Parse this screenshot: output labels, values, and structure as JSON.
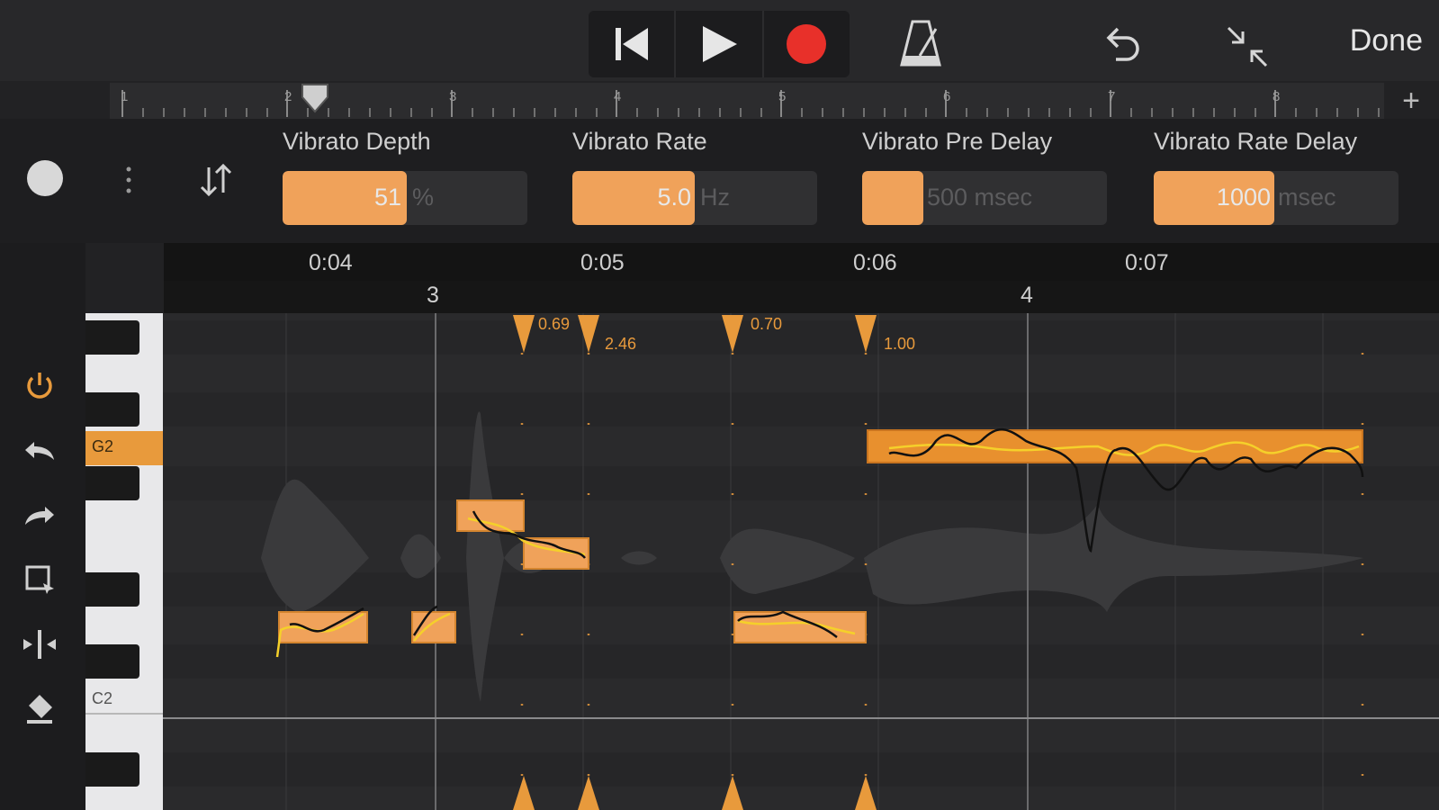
{
  "app": {
    "accent_color": "#f0a25a",
    "record_color": "#e8302a"
  },
  "toolbar": {
    "skip_back_icon": "skip-to-start-icon",
    "play_icon": "play-icon",
    "record_icon": "record-icon",
    "metronome_icon": "metronome-icon",
    "undo_icon": "undo-icon",
    "collapse_icon": "collapse-icon",
    "done_label": "Done"
  },
  "ruler": {
    "bars": [
      "1",
      "2",
      "3",
      "4",
      "5",
      "6",
      "7",
      "8"
    ],
    "add_icon": "plus-icon",
    "add_label": "+"
  },
  "vibrato": [
    {
      "label": "Vibrato Depth",
      "value": "51",
      "unit": "%",
      "fraction": 0.51
    },
    {
      "label": "Vibrato Rate",
      "value": "5.0",
      "unit": "Hz",
      "fraction": 0.5
    },
    {
      "label": "Vibrato Pre Delay",
      "value": "",
      "unit": "500 msec",
      "fraction": 0.25
    },
    {
      "label": "Vibrato Rate Delay",
      "value": "1000",
      "unit": "msec",
      "fraction": 0.5
    }
  ],
  "timeline": {
    "times": [
      "0:04",
      "0:05",
      "0:06",
      "0:07"
    ],
    "bars": [
      "3",
      "4"
    ]
  },
  "piano": {
    "g2_label": "G2",
    "c2_label": "C2"
  },
  "markers": [
    "0.69",
    "2.46",
    "0.70",
    "1.00"
  ],
  "side_tools": [
    "power-icon",
    "undo-icon",
    "redo-icon",
    "select-icon",
    "split-icon",
    "eraser-icon"
  ]
}
